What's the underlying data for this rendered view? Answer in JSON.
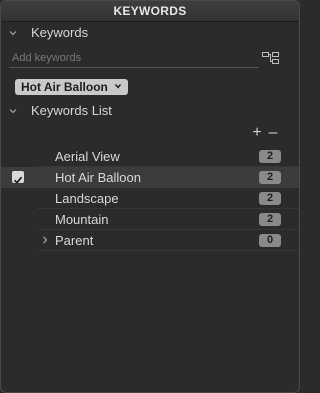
{
  "window": {
    "title": "KEYWORDS"
  },
  "keywords_section": {
    "label": "Keywords",
    "input_placeholder": "Add keywords",
    "input_value": "",
    "token_label": "Hot Air Balloon"
  },
  "list_section": {
    "label": "Keywords List",
    "add_label": "+",
    "remove_label": "–",
    "items": [
      {
        "label": "Aerial View",
        "count": "2",
        "checked": false,
        "expandable": false
      },
      {
        "label": "Hot Air Balloon",
        "count": "2",
        "checked": true,
        "expandable": false
      },
      {
        "label": "Landscape",
        "count": "2",
        "checked": false,
        "expandable": false
      },
      {
        "label": "Mountain",
        "count": "2",
        "checked": false,
        "expandable": false
      },
      {
        "label": "Parent",
        "count": "0",
        "checked": false,
        "expandable": true
      }
    ]
  },
  "icons": {
    "section_chevron": "chevron-down-icon",
    "tree_view": "tree-view-icon",
    "token_menu": "chevron-down-icon",
    "expand": "chevron-right-icon",
    "checkbox": "checkmark-icon"
  },
  "colors": {
    "background": "#2b2b2b",
    "selected_row": "#3c3c3c",
    "token_bg": "#c9c9c9",
    "count_badge": "#8a8a8a"
  }
}
